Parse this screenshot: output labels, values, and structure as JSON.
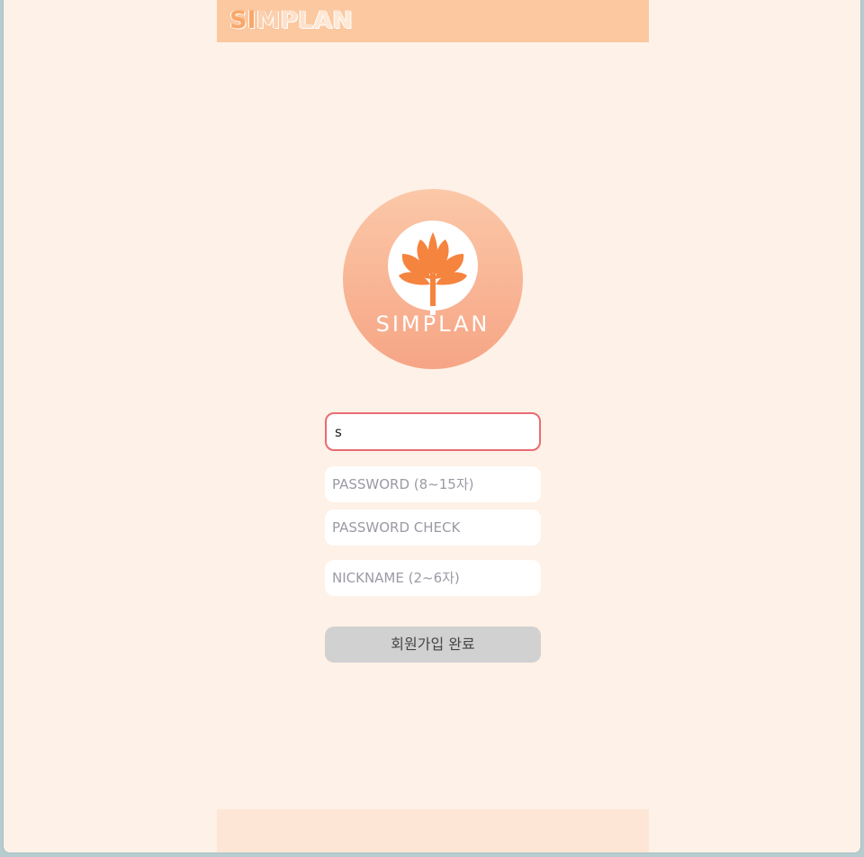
{
  "header": {
    "brand_letters": [
      {
        "char": "S",
        "tone": "c1"
      },
      {
        "char": "I",
        "tone": "c1"
      },
      {
        "char": "M",
        "tone": "c2"
      },
      {
        "char": "P",
        "tone": "c3"
      },
      {
        "char": "L",
        "tone": "c3"
      },
      {
        "char": "A",
        "tone": "c4"
      },
      {
        "char": "N",
        "tone": "c4"
      }
    ]
  },
  "logo": {
    "text": "SIMPLAN",
    "icon": "tree-icon"
  },
  "form": {
    "id_value": "s",
    "password_placeholder": "PASSWORD (8~15자)",
    "password_check_placeholder": "PASSWORD CHECK",
    "nickname_placeholder": "NICKNAME (2~6자)",
    "submit_label": "회원가입 완료"
  },
  "colors": {
    "background": "#fef1e7",
    "header": "#fbc8a0",
    "footer": "#fee6d6",
    "focus_border": "#e86c72",
    "button": "#d1d1d1",
    "logo_orange": "#f5843f"
  }
}
